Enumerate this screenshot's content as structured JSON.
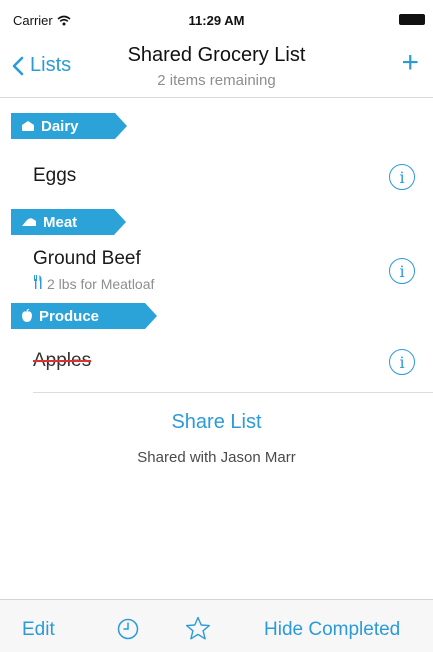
{
  "status_bar": {
    "carrier": "Carrier",
    "time": "11:29 AM"
  },
  "nav": {
    "back_label": "Lists",
    "title": "Shared Grocery List",
    "subtitle": "2 items remaining",
    "add_label": "+"
  },
  "categories": [
    {
      "label": "Dairy",
      "icon": "cheese-icon"
    },
    {
      "label": "Meat",
      "icon": "meat-icon"
    },
    {
      "label": "Produce",
      "icon": "apple-icon"
    }
  ],
  "items": [
    {
      "name": "Eggs",
      "completed": false
    },
    {
      "name": "Ground Beef",
      "note": "2 lbs for Meatloaf",
      "note_icon": "fork-knife-icon",
      "completed": false
    },
    {
      "name": "Apples",
      "completed": true
    }
  ],
  "info_glyph": "i",
  "share": {
    "label": "Share List",
    "shared_with": "Shared with Jason Marr"
  },
  "toolbar": {
    "edit_label": "Edit",
    "hide_completed_label": "Hide Completed"
  },
  "colors": {
    "accent": "#2b9bd8",
    "ribbon": "#2ba3d8",
    "strike": "#e03030"
  }
}
